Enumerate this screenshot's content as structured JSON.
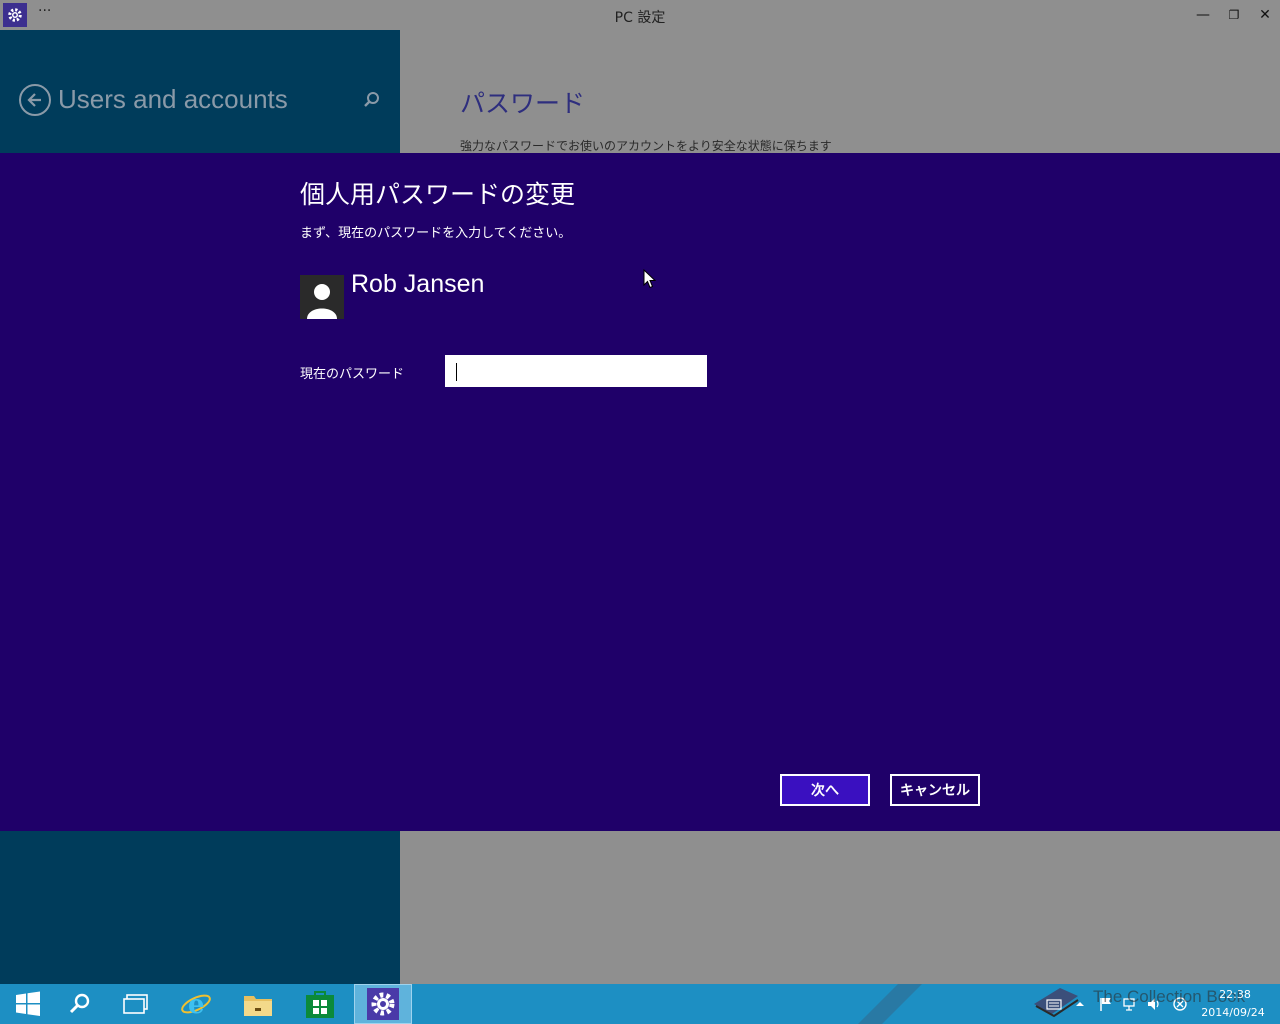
{
  "window": {
    "title": "PC 設定",
    "menu_dots": "···",
    "minimize_glyph": "—",
    "maximize_glyph": "❐",
    "close_glyph": "✕",
    "icon": "gear-icon"
  },
  "left_pane": {
    "title": "Users and accounts",
    "back_icon": "back-arrow-icon",
    "search_icon": "search-icon"
  },
  "right_pane": {
    "section_title": "パスワード",
    "section_desc": "強力なパスワードでお使いのアカウントをより安全な状態に保ちます"
  },
  "dialog": {
    "title": "個人用パスワードの変更",
    "instruction": "まず、現在のパスワードを入力してください。",
    "user_name": "Rob Jansen",
    "password_label": "現在のパスワード",
    "password_value": "",
    "next_label": "次へ",
    "cancel_label": "キャンセル"
  },
  "taskbar": {
    "items": [
      "start-icon",
      "search-icon",
      "task-view-icon",
      "internet-explorer-icon",
      "file-explorer-icon",
      "store-icon",
      "settings-icon"
    ],
    "watermark": "The Collection Book",
    "clock_time": "22:38",
    "clock_date": "2014/09/24"
  },
  "colors": {
    "dialog_bg": "#1f0069",
    "left_pane_bg": "#003c5b",
    "taskbar_bg": "#1d8fc3",
    "accent_button": "#3a10c0"
  }
}
